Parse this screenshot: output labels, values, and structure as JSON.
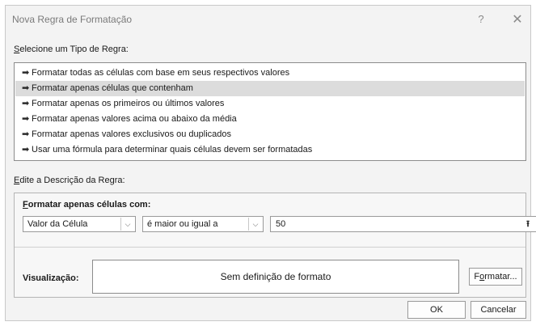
{
  "window": {
    "title": "Nova Regra de Formatação",
    "help": "?",
    "close": "✕"
  },
  "rule_type": {
    "label_u": "S",
    "label_rest": "elecione um Tipo de Regra:",
    "items": [
      {
        "label": "Formatar todas as células com base em seus respectivos valores",
        "selected": false
      },
      {
        "label": "Formatar apenas células que contenham",
        "selected": true
      },
      {
        "label": "Formatar apenas os primeiros ou últimos valores",
        "selected": false
      },
      {
        "label": "Formatar apenas valores acima ou abaixo da média",
        "selected": false
      },
      {
        "label": "Formatar apenas valores exclusivos ou duplicados",
        "selected": false
      },
      {
        "label": "Usar uma fórmula para determinar quais células devem ser formatadas",
        "selected": false
      }
    ],
    "arrow": "➡"
  },
  "description": {
    "label_u": "E",
    "label_rest": "dite a Descrição da Regra:",
    "heading_u": "F",
    "heading_rest": "ormatar apenas células com:",
    "condition1": "Valor da Célula",
    "condition2": "é maior ou igual a",
    "value": "50",
    "collapse_icon": "⭱",
    "dropdown_icon": "⌵"
  },
  "preview": {
    "label": "Visualização:",
    "text": "Sem definição de formato",
    "format_button_pre": "F",
    "format_button_u": "o",
    "format_button_post": "rmatar..."
  },
  "buttons": {
    "ok": "OK",
    "cancel": "Cancelar"
  }
}
